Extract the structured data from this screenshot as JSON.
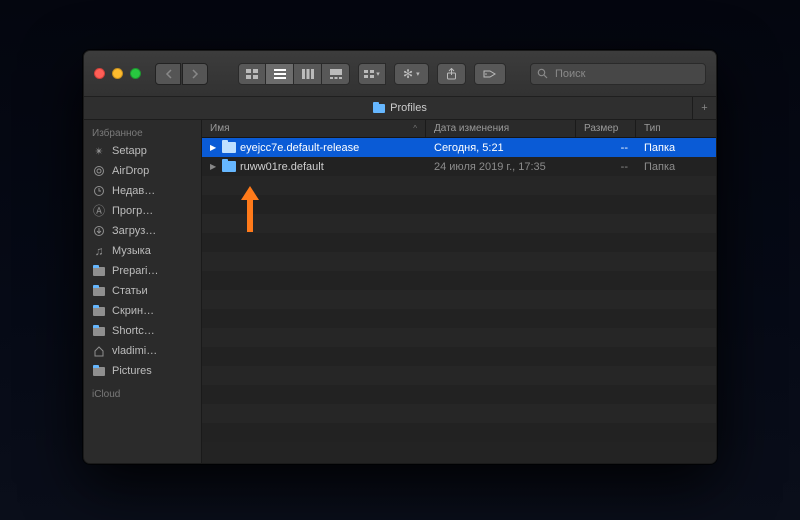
{
  "window": {
    "title_folder": "Profiles",
    "path_label": "Profiles"
  },
  "toolbar": {
    "search_placeholder": "Поиск"
  },
  "sidebar": {
    "section_favorites": "Избранное",
    "section_icloud": "iCloud",
    "items": [
      {
        "icon": "setapp",
        "label": "Setapp"
      },
      {
        "icon": "airdrop",
        "label": "AirDrop"
      },
      {
        "icon": "recents",
        "label": "Недав…"
      },
      {
        "icon": "apps",
        "label": "Прогр…"
      },
      {
        "icon": "download",
        "label": "Загруз…"
      },
      {
        "icon": "music",
        "label": "Музыка"
      },
      {
        "icon": "folder",
        "label": "Prepari…"
      },
      {
        "icon": "folder",
        "label": "Статьи"
      },
      {
        "icon": "folder",
        "label": "Скрин…"
      },
      {
        "icon": "folder",
        "label": "Shortc…"
      },
      {
        "icon": "home",
        "label": "vladimi…"
      },
      {
        "icon": "folder",
        "label": "Pictures"
      }
    ]
  },
  "columns": {
    "name": "Имя",
    "date": "Дата изменения",
    "size": "Размер",
    "kind": "Тип"
  },
  "rows": [
    {
      "selected": true,
      "name": "eyejcc7e.default-release",
      "date": "Сегодня, 5:21",
      "size": "--",
      "kind": "Папка"
    },
    {
      "selected": false,
      "name": "ruww01re.default",
      "date": "24 июля 2019 г., 17:35",
      "size": "--",
      "kind": "Папка"
    }
  ],
  "blank_row_count": 14
}
